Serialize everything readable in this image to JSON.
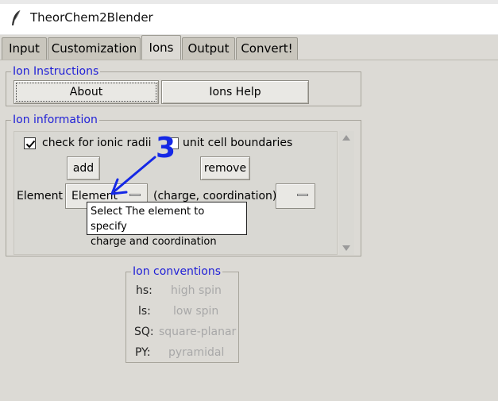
{
  "window": {
    "title": "TheorChem2Blender"
  },
  "tabs": [
    {
      "label": "Input"
    },
    {
      "label": "Customization"
    },
    {
      "label": "Ions",
      "active": true
    },
    {
      "label": "Output"
    },
    {
      "label": "Convert!"
    }
  ],
  "ion_instructions": {
    "label": "Ion Instructions",
    "about_button": "About",
    "help_button": "Ions Help"
  },
  "ion_information": {
    "label": "Ion information",
    "ionic_radii_checkbox": {
      "label": "check for ionic radii",
      "checked": true
    },
    "unit_cell_label": "unit cell boundaries",
    "add_button": "add",
    "remove_button": "remove",
    "element_label": "Element",
    "element_menu_value": "Element",
    "charge_coordination_label": "(charge, coordination)",
    "tooltip": "Select The element to specify\ncharge and coordination"
  },
  "ion_conventions": {
    "label": "Ion conventions",
    "items": [
      {
        "key": "hs:",
        "value": "high spin"
      },
      {
        "key": "ls:",
        "value": "low spin"
      },
      {
        "key": "SQ:",
        "value": "square-planar"
      },
      {
        "key": "PY:",
        "value": "pyramidal"
      }
    ]
  },
  "annotation": {
    "step_number": "3",
    "color": "#1528e6"
  },
  "colors": {
    "group_label": "#1f1fd6",
    "background": "#dcdad5"
  }
}
